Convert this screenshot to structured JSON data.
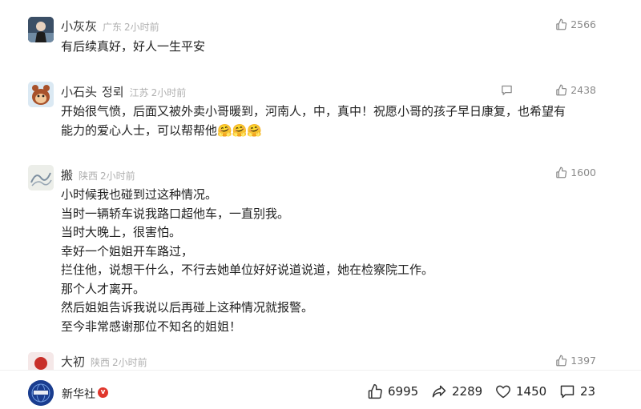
{
  "comments": [
    {
      "username": "小灰灰",
      "region": "广东",
      "time": "2小时前",
      "likes": "2566",
      "lines": [
        "有后续真好，好人一生平安"
      ]
    },
    {
      "username": "小石头",
      "username_tag": "정뢰",
      "region": "江苏",
      "time": "2小时前",
      "likes": "2438",
      "lines": [
        "开始很气愤，后面又被外卖小哥暖到，河南人，中，真中！祝愿小哥的孩子早日康复，也希望有",
        "能力的爱心人士，可以帮帮他"
      ],
      "emoji": [
        "🤗",
        "🤗",
        "🤗"
      ]
    },
    {
      "username": "搬",
      "region": "陕西",
      "time": "2小时前",
      "likes": "1600",
      "lines": [
        "小时候我也碰到过这种情况。",
        "当时一辆轿车说我路口超他车，一直别我。",
        "当时大晚上，很害怕。",
        "幸好一个姐姐开车路过，",
        "拦住他，说想干什么，不行去她单位好好说道说道，她在检察院工作。",
        "那个人才离开。",
        "然后姐姐告诉我说以后再碰上这种情况就报警。",
        "至今非常感谢那位不知名的姐姐！"
      ]
    },
    {
      "username": "大初",
      "region": "陕西",
      "time": "2小时前",
      "likes": "1397"
    }
  ],
  "bottombar": {
    "brand": "新华社",
    "likes": "6995",
    "shares": "2289",
    "favorites": "1450",
    "comments": "23"
  },
  "colors": {
    "muted": "#b0b0b0",
    "brand_blue": "#1a3d8f",
    "verified_red": "#e0362c"
  }
}
